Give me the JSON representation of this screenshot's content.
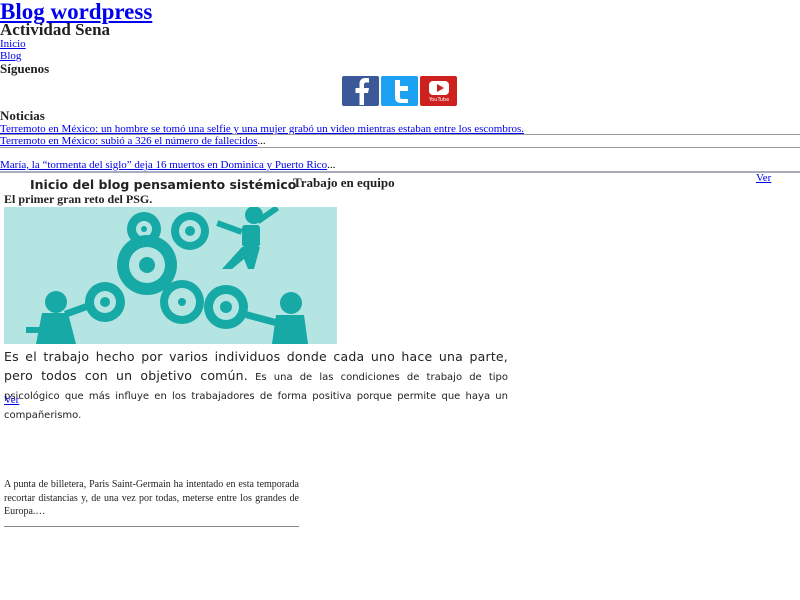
{
  "site": {
    "title": "Blog wordpress",
    "description": "Actividad Sena"
  },
  "menu": [
    {
      "label": "Inicio"
    },
    {
      "label": "Blog"
    }
  ],
  "follow": {
    "heading": "Síguenos",
    "networks": [
      {
        "name": "facebook-icon",
        "color": "#3b5998"
      },
      {
        "name": "twitter-icon",
        "color": "#1da1f2"
      },
      {
        "name": "youtube-icon",
        "color": "#cd201f",
        "label": "YouTube"
      }
    ]
  },
  "news": {
    "heading": "Noticias",
    "items": [
      {
        "text": "Terremoto en México: un hombre se tomó una selfie y una mujer grabó un video mientras estaban entre los escombros.",
        "suffix": ""
      },
      {
        "text": "Terremoto en México: subió a 326 el número de fallecidos",
        "suffix": "..."
      },
      {
        "text": "María, la “tormenta del siglo” deja 16 muertos en Dominica y Puerto Rico",
        "suffix": "..."
      }
    ]
  },
  "posts": {
    "post1_title": "Inicio del blog pensamiento sistémico",
    "post2_title": "Trabajo en equipo",
    "ver_label": "Ver",
    "psg_title": "El primer gran reto del PSG.",
    "body_lead": "Es el trabajo hecho por varios individuos donde cada uno hace una parte, pero todos con un objetivo común.",
    "body_rest": " Es una de las condiciones de trabajo de tipo psicológico que más influye en los trabajadores de forma positiva porque permite que haya un compañerismo.",
    "excerpt": "A punta de billetera, Paris Saint-Germain ha intentado en esta temporada recortar distancias y, de una vez por todas, meterse entre los grandes de Europa.…"
  },
  "colors": {
    "link": "#0000ee",
    "illustration_bg": "#b5e5e3",
    "illustration_fg": "#17a9a6"
  }
}
